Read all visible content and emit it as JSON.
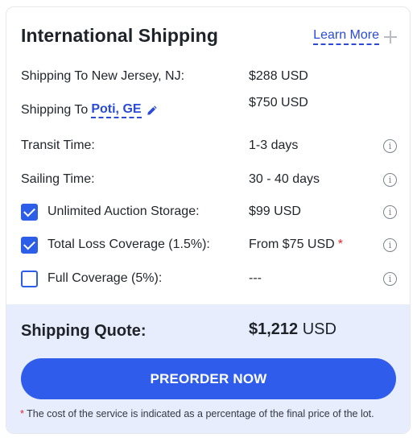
{
  "header": {
    "title": "International Shipping",
    "learn_more": "Learn More"
  },
  "rows": {
    "shipping_nj": {
      "label": "Shipping To New Jersey, NJ:",
      "value": "$288 USD"
    },
    "shipping_poti": {
      "label_prefix": "Shipping To",
      "port": "Poti, GE",
      "value": "$750 USD"
    },
    "transit": {
      "label": "Transit Time:",
      "value": "1-3 days"
    },
    "sailing": {
      "label": "Sailing Time:",
      "value": "30 - 40 days"
    },
    "storage": {
      "label": "Unlimited Auction Storage:",
      "value": "$99 USD",
      "checked": true
    },
    "total_loss": {
      "label": "Total Loss Coverage (1.5%):",
      "value": "From $75 USD",
      "asterisk": "*",
      "checked": true
    },
    "full_coverage": {
      "label": "Full Coverage (5%):",
      "value": "---",
      "checked": false
    }
  },
  "quote": {
    "label": "Shipping Quote:",
    "amount": "$1,212",
    "currency": "USD",
    "button": "PREORDER NOW",
    "footnote_star": "*",
    "footnote": "The cost of the service is indicated as a percentage of the final price of the lot."
  },
  "icons": {
    "info": "info-circle-icon",
    "edit": "pencil-icon",
    "plus": "plus-icon",
    "check": "checkmark-icon"
  },
  "colors": {
    "accent": "#2f5ceb",
    "link": "#2a4bd9",
    "quote_bg": "#e8edfd",
    "asterisk": "#e0242f"
  }
}
